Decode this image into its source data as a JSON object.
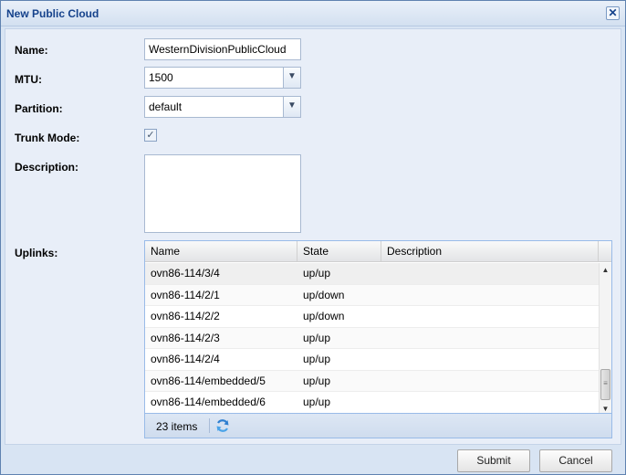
{
  "dialog": {
    "title": "New Public Cloud",
    "close_symbol": "✕"
  },
  "form": {
    "name_label": "Name:",
    "name_value": "WesternDivisionPublicCloud",
    "mtu_label": "MTU:",
    "mtu_value": "1500",
    "partition_label": "Partition:",
    "partition_value": "default",
    "trunk_label": "Trunk Mode:",
    "trunk_checked": true,
    "description_label": "Description:",
    "description_value": "",
    "uplinks_label": "Uplinks:"
  },
  "uplinks": {
    "columns": [
      "Name",
      "State",
      "Description"
    ],
    "rows": [
      {
        "name": "ovn86-114/3/4",
        "state": "up/up",
        "description": ""
      },
      {
        "name": "ovn86-114/2/1",
        "state": "up/down",
        "description": ""
      },
      {
        "name": "ovn86-114/2/2",
        "state": "up/down",
        "description": ""
      },
      {
        "name": "ovn86-114/2/3",
        "state": "up/up",
        "description": ""
      },
      {
        "name": "ovn86-114/2/4",
        "state": "up/up",
        "description": ""
      },
      {
        "name": "ovn86-114/embedded/5",
        "state": "up/up",
        "description": ""
      },
      {
        "name": "ovn86-114/embedded/6",
        "state": "up/up",
        "description": ""
      }
    ],
    "item_count": "23 items"
  },
  "buttons": {
    "submit": "Submit",
    "cancel": "Cancel"
  },
  "colors": {
    "title_text": "#15428b",
    "panel_bg": "#d8e4f3",
    "grid_border": "#99bbe8"
  },
  "icons": {
    "close": "close-icon",
    "dropdown": "chevron-down-icon",
    "checkbox": "checkmark-icon",
    "refresh": "refresh-icon",
    "scroll_up": "arrow-up-icon",
    "scroll_down": "arrow-down-icon"
  }
}
